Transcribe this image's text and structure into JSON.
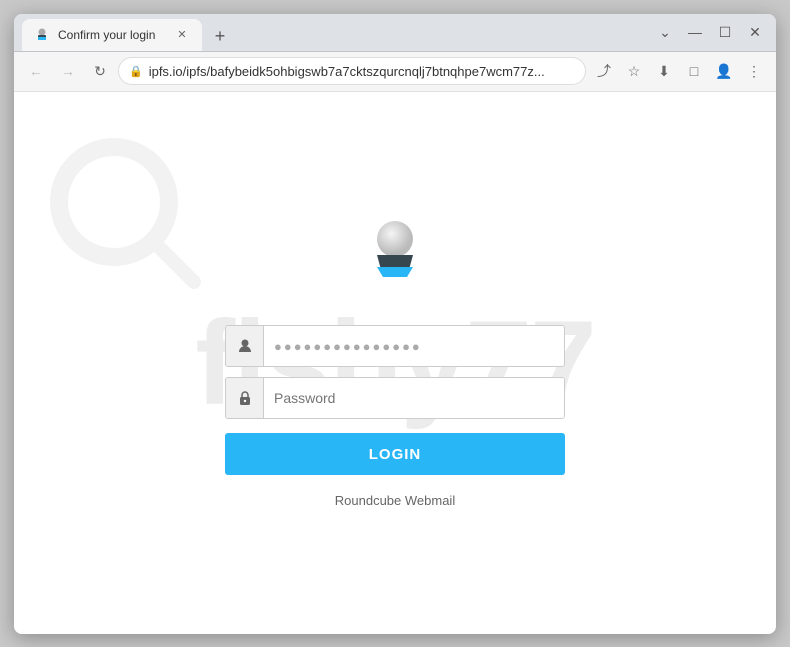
{
  "browser": {
    "tab": {
      "title": "Confirm your login",
      "favicon": "🔷"
    },
    "new_tab_icon": "+",
    "window_controls": {
      "minimize": "—",
      "maximize": "☐",
      "close": "✕"
    },
    "nav": {
      "back": "←",
      "forward": "→",
      "reload": "↻",
      "address": "ipfs.io/ipfs/bafybeidk5ohbigswb7a7cktszqurcnqlj7btnqhpe7wcm77z...",
      "share_icon": "⤴",
      "bookmark_icon": "☆",
      "download_icon": "⬇",
      "extensions_icon": "□",
      "profile_icon": "👤",
      "menu_icon": "⋮"
    }
  },
  "page": {
    "username_placeholder": "●●●●●●●●●●●●●●●",
    "password_placeholder": "Password",
    "login_button": "LOGIN",
    "footer": "Roundcube Webmail",
    "watermark": "fishy77",
    "username_icon": "👤",
    "password_icon": "🔒",
    "lock_icon": "🔒"
  }
}
